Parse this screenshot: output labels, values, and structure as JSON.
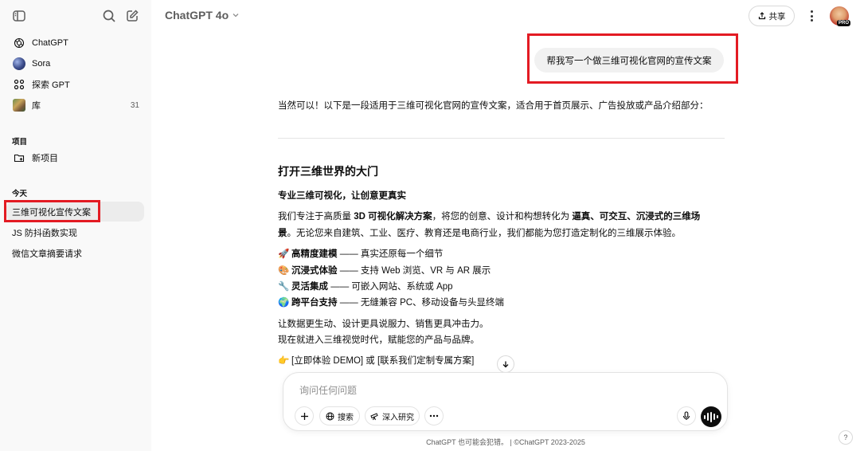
{
  "sidebar": {
    "nav": [
      {
        "label": "ChatGPT",
        "icon": "openai-logo-icon"
      },
      {
        "label": "Sora",
        "icon": "sora-avatar"
      },
      {
        "label": "探索 GPT",
        "icon": "grid-icon"
      },
      {
        "label": "库",
        "icon": "library-thumbnail",
        "count": "31"
      }
    ],
    "projects_title": "项目",
    "new_project": "新项目",
    "today_title": "今天",
    "chats": [
      "三维可视化宣传文案",
      "JS 防抖函数实现",
      "微信文章摘要请求"
    ]
  },
  "header": {
    "model": "ChatGPT 4o",
    "share": "共享",
    "pro_badge": "PRO"
  },
  "conversation": {
    "user_message": "帮我写一个做三维可视化官网的宣传文案",
    "intro": "当然可以！以下是一段适用于三维可视化官网的宣传文案，适合用于首页展示、广告投放或产品介绍部分：",
    "heading": "打开三维世界的大门",
    "subheading": "专业三维可视化，让创意更真实",
    "para1_a": "我们专注于高质量 ",
    "para1_b": "3D 可视化解决方案",
    "para1_c": "，将您的创意、设计和构想转化为 ",
    "para1_d": "逼真、可交互、沉浸式的三维场",
    "para1_e": "景",
    "para1_f": "。无论您来自建筑、工业、医疗、教育还是电商行业，我们都能为您打造定制化的三维展示体验。",
    "features": [
      {
        "emoji": "🚀",
        "title": "高精度建模",
        "desc": " —— 真实还原每一个细节"
      },
      {
        "emoji": "🎨",
        "title": "沉浸式体验",
        "desc": " —— 支持 Web 浏览、VR 与 AR 展示"
      },
      {
        "emoji": "🔧",
        "title": "灵活集成",
        "desc": " —— 可嵌入网站、系统或 App"
      },
      {
        "emoji": "🌍",
        "title": "跨平台支持",
        "desc": " —— 无缝兼容 PC、移动设备与头显终端"
      }
    ],
    "line1": "让数据更生动、设计更具说服力、销售更具冲击力。",
    "line2": "现在就进入三维视觉时代，赋能您的产品与品牌。",
    "cta": "[立即体验 DEMO] 或 [联系我们定制专属方案]",
    "cta_emoji": "👉"
  },
  "composer": {
    "placeholder": "询问任何问题",
    "search": "搜索",
    "deep_research": "深入研究"
  },
  "footer": "ChatGPT 也可能会犯错。 | ©ChatGPT 2023-2025",
  "help": "?"
}
